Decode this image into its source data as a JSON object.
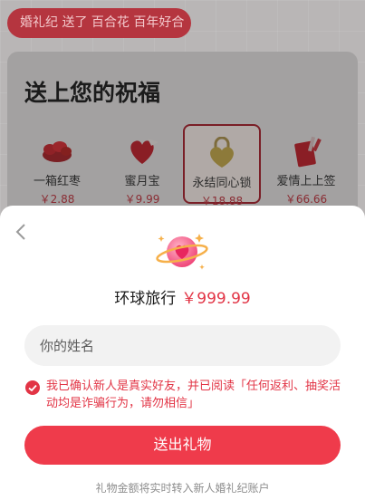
{
  "ticker": {
    "text": "婚礼纪 送了 百合花 百年好合"
  },
  "section": {
    "title": "送上您的祝福"
  },
  "gifts": [
    {
      "name": "一箱红枣",
      "price": "￥2.88",
      "icon": "red-dates-icon"
    },
    {
      "name": "蜜月宝",
      "price": "￥9.99",
      "icon": "honeymoon-icon"
    },
    {
      "name": "永结同心锁",
      "price": "￥18.88",
      "icon": "heart-lock-icon",
      "selected": true
    },
    {
      "name": "爱情上上签",
      "price": "￥66.66",
      "icon": "lucky-lot-icon"
    }
  ],
  "sheet": {
    "gift_name": "环球旅行",
    "gift_amount": "￥999.99",
    "name_placeholder": "你的姓名",
    "agree_text": "我已确认新人是真实好友，并已阅读「任何返利、抽奖活动均是诈骗行为，请勿相信」",
    "send_label": "送出礼物",
    "footnote": "礼物金额将实时转入新人婚礼纪账户"
  },
  "colors": {
    "accent": "#ef3b4b",
    "price_red": "#e23445"
  }
}
